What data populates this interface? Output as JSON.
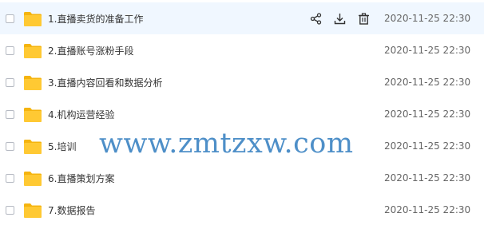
{
  "files": [
    {
      "name": "1.直播卖货的准备工作",
      "time": "2020-11-25 22:30"
    },
    {
      "name": "2.直播账号涨粉手段",
      "time": "2020-11-25 22:30"
    },
    {
      "name": "3.直播内容回看和数据分析",
      "time": "2020-11-25 22:30"
    },
    {
      "name": "4.机构运营经验",
      "time": "2020-11-25 22:30"
    },
    {
      "name": "5.培训",
      "time": "2020-11-25 22:30"
    },
    {
      "name": "6.直播策划方案",
      "time": "2020-11-25 22:30"
    },
    {
      "name": "7.数据报告",
      "time": "2020-11-25 22:30"
    }
  ],
  "hover_actions": [
    "share-icon",
    "download-icon",
    "delete-icon"
  ],
  "watermark": "www.zmtzxw.com",
  "colors": {
    "folder": "#ffc933",
    "folder_tab": "#f5b40f",
    "hover_row": "#f0f7ff",
    "watermark": "#3f86c4"
  }
}
